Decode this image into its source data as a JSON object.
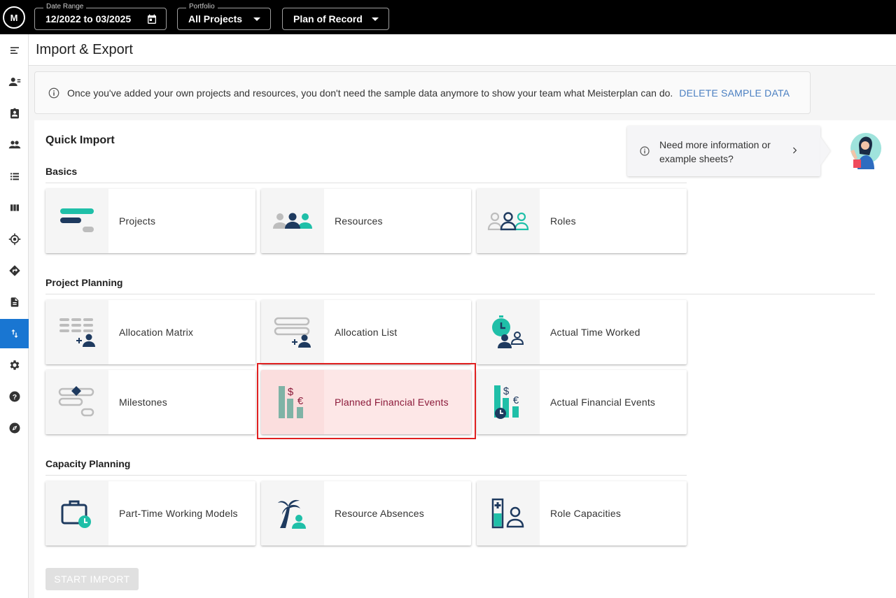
{
  "topbar": {
    "logo_text": "M",
    "date_range": {
      "label": "Date Range",
      "value": "12/2022 to 03/2025"
    },
    "portfolio": {
      "label": "Portfolio",
      "value": "All Projects"
    },
    "scenario": {
      "value": "Plan of Record"
    }
  },
  "sidebar": {
    "items": [
      {
        "name": "menu-icon"
      },
      {
        "name": "resources-icon"
      },
      {
        "name": "badge-icon"
      },
      {
        "name": "team-icon"
      },
      {
        "name": "list-icon"
      },
      {
        "name": "columns-icon"
      },
      {
        "name": "target-icon"
      },
      {
        "name": "route-icon"
      },
      {
        "name": "document-icon"
      },
      {
        "name": "import-export-icon",
        "active": true
      },
      {
        "name": "settings-icon"
      },
      {
        "name": "help-icon"
      },
      {
        "name": "compass-icon"
      }
    ],
    "active_color": "#1976d2"
  },
  "header": {
    "title": "Import & Export"
  },
  "banner": {
    "message": "Once you've added your own projects and resources, you don't need the sample data anymore to show your team what Meisterplan can do.",
    "link": "DELETE SAMPLE DATA"
  },
  "quick_import": {
    "title": "Quick Import",
    "info_card": {
      "text": "Need more information or example sheets?"
    },
    "sections": [
      {
        "title": "Basics",
        "tiles": [
          "Projects",
          "Resources",
          "Roles"
        ]
      },
      {
        "title": "Project Planning",
        "tiles": [
          "Allocation Matrix",
          "Allocation List",
          "Actual Time Worked",
          "Milestones",
          "Planned Financial Events",
          "Actual Financial Events"
        ]
      },
      {
        "title": "Capacity Planning",
        "tiles": [
          "Part-Time Working Models",
          "Resource Absences",
          "Role Capacities"
        ]
      }
    ],
    "selected_tile": "Planned Financial Events",
    "start_button": "START IMPORT"
  },
  "colors": {
    "teal": "#1fbfa8",
    "navy": "#1e3a5f",
    "grey": "#bdbdbd",
    "highlight": "#fde7e7",
    "outline": "#e02020"
  }
}
